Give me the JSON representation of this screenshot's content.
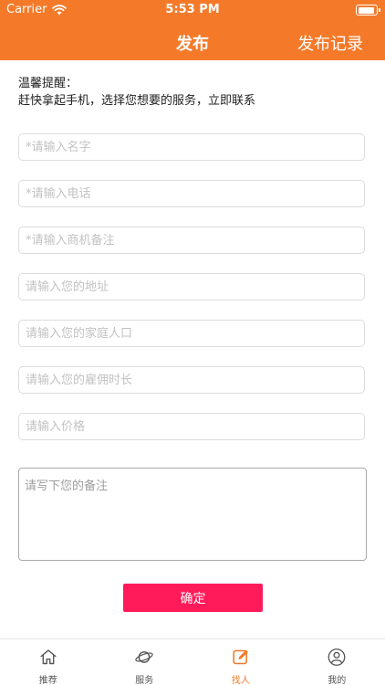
{
  "status_bar": {
    "carrier": "Carrier",
    "time": "5:53 PM"
  },
  "nav": {
    "title": "发布",
    "right_action": "发布记录"
  },
  "reminder": {
    "heading": "温馨提醒：",
    "text": "赶快拿起手机，选择您想要的服务，立即联系"
  },
  "form": {
    "name_placeholder": "*请输入名字",
    "phone_placeholder": "*请输入电话",
    "business_notes_placeholder": "*请输入商机备注",
    "address_placeholder": "请输入您的地址",
    "household_placeholder": "请输入您的家庭人口",
    "duration_placeholder": "请输入您的雇佣时长",
    "price_placeholder": "请输入价格",
    "remarks_placeholder": "请写下您的备注",
    "confirm_label": "确定"
  },
  "tabbar": {
    "items": [
      {
        "label": "推荐",
        "icon": "home-icon"
      },
      {
        "label": "服务",
        "icon": "planet-icon"
      },
      {
        "label": "找人",
        "icon": "edit-icon"
      },
      {
        "label": "我的",
        "icon": "user-icon"
      }
    ],
    "active_index": 2
  },
  "colors": {
    "primary": "#f47a2a",
    "confirm": "#ff1a5a"
  }
}
